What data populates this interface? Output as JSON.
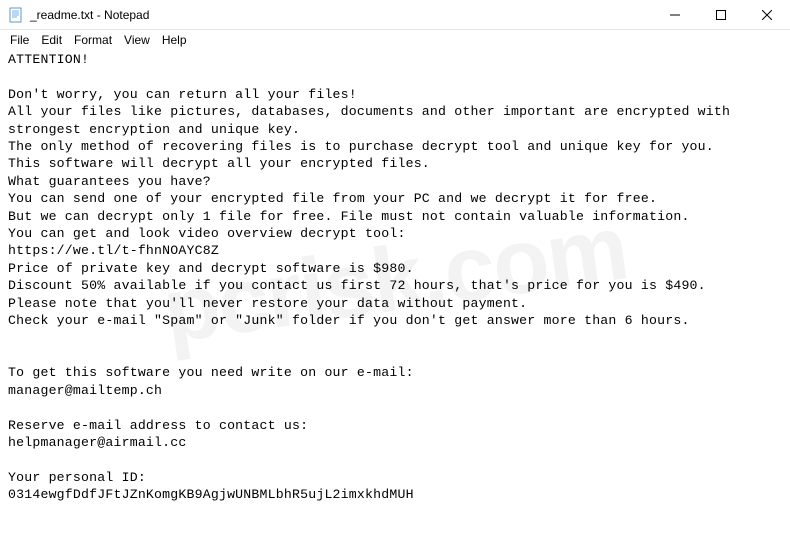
{
  "window": {
    "title": "_readme.txt - Notepad",
    "minimize": "—",
    "maximize": "☐",
    "close": "✕"
  },
  "menu": {
    "file": "File",
    "edit": "Edit",
    "format": "Format",
    "view": "View",
    "help": "Help"
  },
  "document": {
    "text": "ATTENTION!\n\nDon't worry, you can return all your files!\nAll your files like pictures, databases, documents and other important are encrypted with strongest encryption and unique key.\nThe only method of recovering files is to purchase decrypt tool and unique key for you.\nThis software will decrypt all your encrypted files.\nWhat guarantees you have?\nYou can send one of your encrypted file from your PC and we decrypt it for free.\nBut we can decrypt only 1 file for free. File must not contain valuable information.\nYou can get and look video overview decrypt tool:\nhttps://we.tl/t-fhnNOAYC8Z\nPrice of private key and decrypt software is $980.\nDiscount 50% available if you contact us first 72 hours, that's price for you is $490.\nPlease note that you'll never restore your data without payment.\nCheck your e-mail \"Spam\" or \"Junk\" folder if you don't get answer more than 6 hours.\n\n\nTo get this software you need write on our e-mail:\nmanager@mailtemp.ch\n\nReserve e-mail address to contact us:\nhelpmanager@airmail.cc\n\nYour personal ID:\n0314ewgfDdfJFtJZnKomgKB9AgjwUNBMLbhR5ujL2imxkhdMUH"
  },
  "watermark": "pcrisk.com"
}
